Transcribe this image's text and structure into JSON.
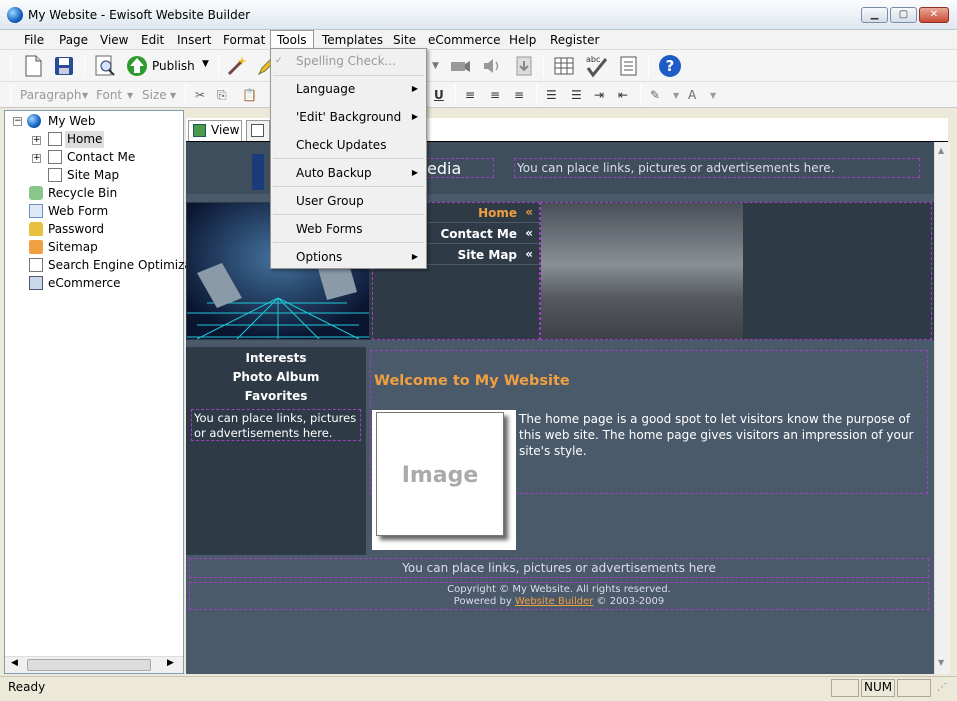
{
  "window": {
    "title": "My Website - Ewisoft Website Builder"
  },
  "menu": [
    "File",
    "Page",
    "View",
    "Edit",
    "Insert",
    "Format",
    "Tools",
    "Templates",
    "Site",
    "eCommerce",
    "Help",
    "Register"
  ],
  "toolbar": {
    "publish_label": "Publish"
  },
  "format_bar": {
    "paragraph": "Paragraph",
    "font": "Font",
    "size": "Size"
  },
  "tree": {
    "root": "My Web",
    "items": [
      "Home",
      "Contact Me",
      "Site Map",
      "Recycle Bin",
      "Web Form",
      "Password",
      "Sitemap",
      "Search Engine Optimizati",
      "eCommerce"
    ]
  },
  "tabs": {
    "view": "View"
  },
  "site": {
    "logo_text_fragment": "edia",
    "header_ad": "You can place links, pictures or advertisements here.",
    "nav": [
      "Home",
      "Contact Me",
      "Site Map"
    ],
    "nav_arrow": "«",
    "side_links": [
      "Interests",
      "Photo Album",
      "Favorites"
    ],
    "side_ad": "You can place links, pictures or advertisements here.",
    "welcome": "Welcome to My Website",
    "image_placeholder": "Image",
    "body_text": "The home page is a good spot to let visitors know the purpose of this web site. The home page gives visitors an impression of your site's style.",
    "footer_ad": "You can place links, pictures or advertisements here",
    "copyright": "Copyright © My Website. All rights reserved.",
    "powered_prefix": "Powered by ",
    "powered_link": "Website Builder",
    "powered_suffix": " © 2003-2009",
    "colors": {
      "bg": "#4a5a6a",
      "accent": "#f0a040",
      "dash": "#a040c0"
    }
  },
  "tools_menu": {
    "items": [
      "Spelling Check...",
      "Language",
      "'Edit' Background",
      "Check Updates",
      "Auto Backup",
      "User Group",
      "Web Forms",
      "Options"
    ]
  },
  "status": {
    "ready": "Ready",
    "num": "NUM"
  }
}
